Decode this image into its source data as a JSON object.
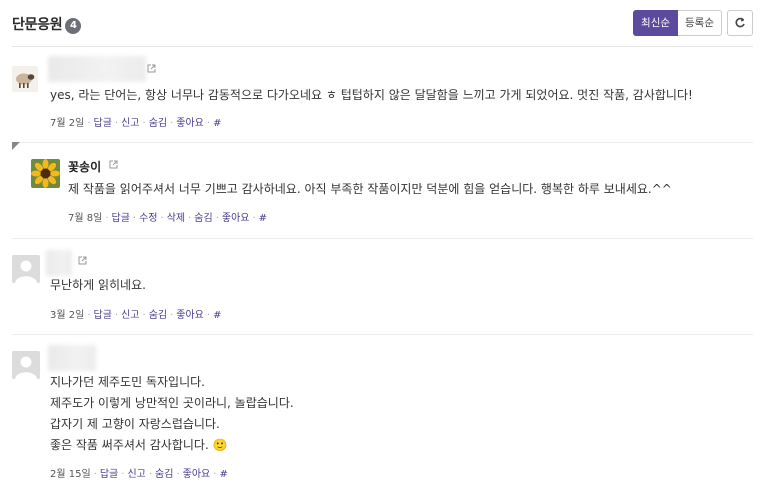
{
  "header": {
    "title": "단문응원",
    "count": "4",
    "sort_latest": "최신순",
    "sort_registered": "등록순"
  },
  "comments": [
    {
      "body": [
        "yes, 라는 단어는, 항상 너무나 감동적으로 다가오네요 ㅎ 텁텁하지 않은 달달함을 느끼고 가게 되었어요. 멋진 작품, 감사합니다!"
      ],
      "meta": {
        "date": "7월 2일",
        "reply": "답글",
        "report": "신고",
        "hide": "숨김",
        "like": "좋아요",
        "hash": "#"
      }
    },
    {
      "author": "꽃송이",
      "body": [
        "제 작품을 읽어주셔서 너무 기쁘고 감사하네요. 아직 부족한 작품이지만 덕분에 힘을 얻습니다. 행복한 하루 보내세요.^^"
      ],
      "meta": {
        "date": "7월 8일",
        "reply": "답글",
        "edit": "수정",
        "delete": "삭제",
        "hide": "숨김",
        "like": "좋아요",
        "hash": "#"
      }
    },
    {
      "body": [
        "무난하게 읽히네요."
      ],
      "meta": {
        "date": "3월 2일",
        "reply": "답글",
        "report": "신고",
        "hide": "숨김",
        "like": "좋아요",
        "hash": "#"
      }
    },
    {
      "body": [
        "지나가던 제주도민 독자입니다.",
        "제주도가 이렇게 낭만적인 곳이라니, 놀랍습니다.",
        "갑자기 제 고향이 자랑스럽습니다.",
        "좋은 작품 써주셔서 감사합니다. 🙂"
      ],
      "meta": {
        "date": "2월 15일",
        "reply": "답글",
        "report": "신고",
        "hide": "숨김",
        "like": "좋아요",
        "hash": "#"
      }
    }
  ],
  "colors": {
    "accent": "#5b4a9e",
    "link": "#4a3d8f"
  }
}
